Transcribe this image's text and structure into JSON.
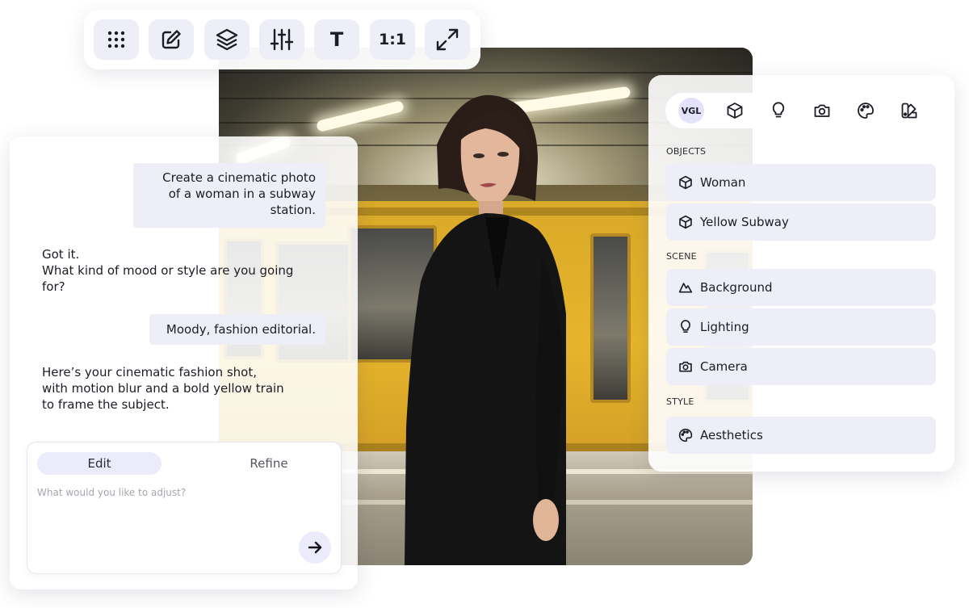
{
  "toolbar": {
    "buttons": [
      {
        "icon": "grid-dots-icon"
      },
      {
        "icon": "edit-icon"
      },
      {
        "icon": "layers-icon"
      },
      {
        "icon": "sliders-icon"
      },
      {
        "icon": "text-icon",
        "label": "T"
      },
      {
        "icon": "aspect-ratio-icon",
        "label": "1:1"
      },
      {
        "icon": "expand-icon"
      }
    ]
  },
  "chat": {
    "messages": [
      {
        "role": "user",
        "text": "Create a cinematic photo of a woman in a subway station.",
        "lines": [
          "Create a cinematic photo",
          "of a woman in a subway",
          "station."
        ]
      },
      {
        "role": "assistant",
        "lines": [
          "Got it.",
          "What kind of mood or style are you going",
          "for?"
        ]
      },
      {
        "role": "user",
        "text": "Moody, fashion editorial."
      },
      {
        "role": "assistant",
        "lines": [
          "Here’s your cinematic fashion shot,",
          "with motion blur and a bold yellow train",
          "to frame the subject."
        ]
      }
    ],
    "composer": {
      "tabs": [
        {
          "label": "Edit",
          "active": true
        },
        {
          "label": "Refine",
          "active": false
        }
      ],
      "placeholder": "What would you like to adjust?"
    }
  },
  "panel": {
    "tabs": [
      {
        "label": "VGL",
        "active": true
      },
      {
        "icon": "cube-icon"
      },
      {
        "icon": "lightbulb-icon"
      },
      {
        "icon": "camera-icon"
      },
      {
        "icon": "palette-icon"
      },
      {
        "icon": "swatch-icon"
      }
    ],
    "sections": [
      {
        "title": "OBJECTS",
        "items": [
          {
            "icon": "cube-icon",
            "label": "Woman"
          },
          {
            "icon": "cube-icon",
            "label": "Yellow Subway"
          }
        ]
      },
      {
        "title": "SCENE",
        "items": [
          {
            "icon": "mountain-icon",
            "label": "Background"
          },
          {
            "icon": "lightbulb-icon",
            "label": "Lighting"
          },
          {
            "icon": "camera-icon",
            "label": "Camera"
          }
        ]
      },
      {
        "title": "STYLE",
        "items": [
          {
            "icon": "palette-icon",
            "label": "Aesthetics"
          }
        ]
      }
    ]
  },
  "colors": {
    "accent_bg": "#eeeef9",
    "active_tab": "#e4e1fb",
    "train_yellow": "#e6b52c",
    "text": "#1c1c24"
  }
}
